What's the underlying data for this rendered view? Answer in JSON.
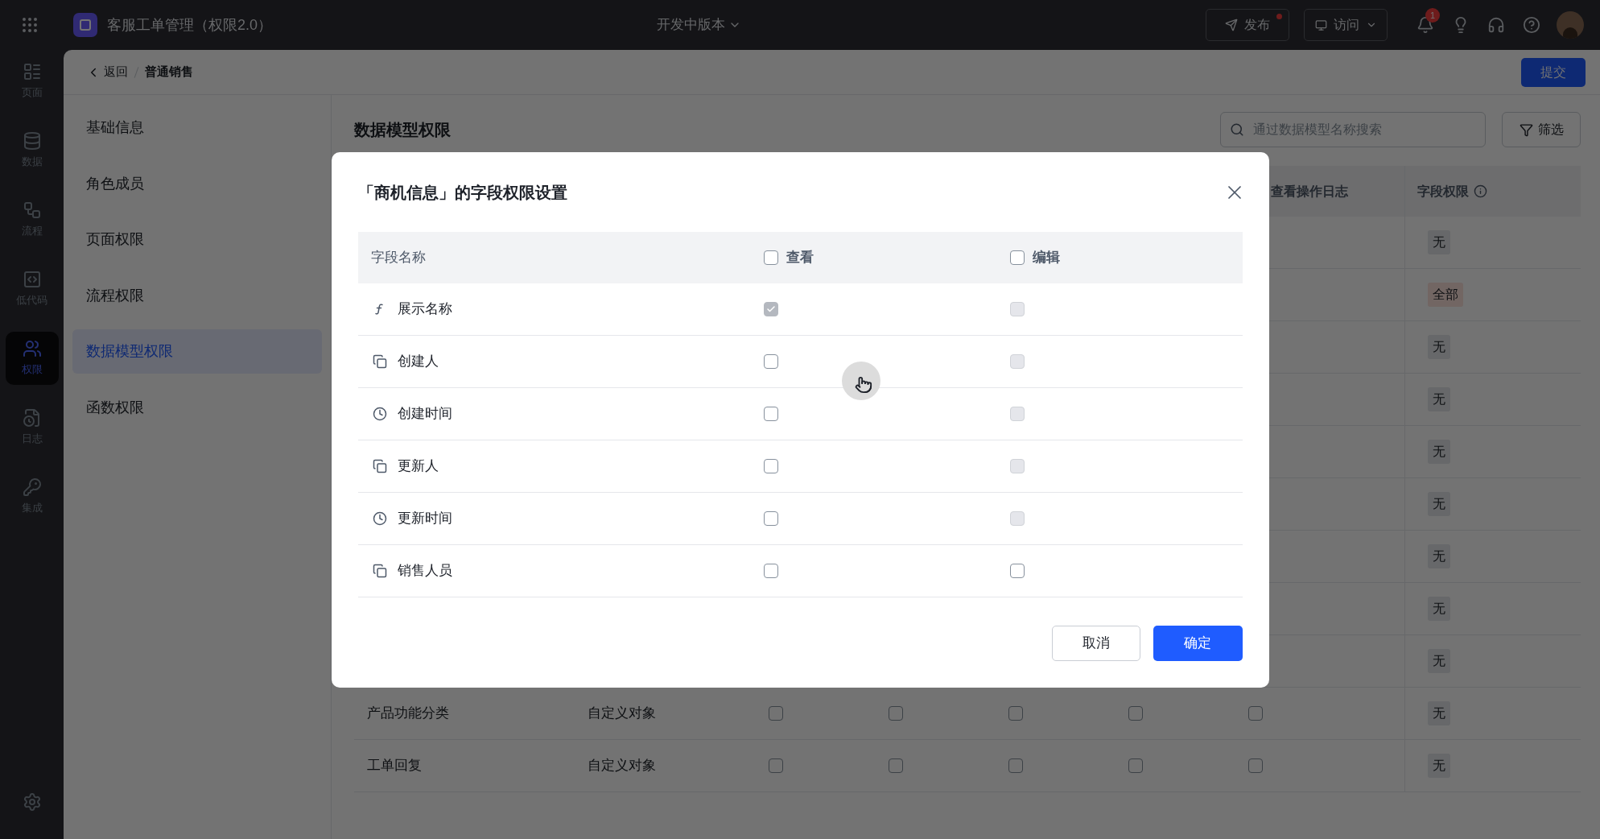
{
  "top_bar": {
    "app_title": "客服工单管理（权限2.0）",
    "version": "开发中版本",
    "publish_button": {
      "label": "发布",
      "unpublished": true
    },
    "visit_button": "访问",
    "notification_count": "1"
  },
  "rail": {
    "items": [
      {
        "kind": "page",
        "label": "页面",
        "selected": false
      },
      {
        "kind": "data",
        "label": "数据",
        "selected": false
      },
      {
        "kind": "flow",
        "label": "流程",
        "selected": false
      },
      {
        "kind": "code",
        "label": "低代码",
        "selected": false
      },
      {
        "kind": "permission",
        "label": "权限",
        "selected": true
      },
      {
        "kind": "log",
        "label": "日志",
        "selected": false
      },
      {
        "kind": "integration",
        "label": "集成",
        "selected": false
      }
    ]
  },
  "breadcrumb": {
    "back": "返回",
    "current": "普通销售"
  },
  "submit_button": "提交",
  "menu": {
    "items": [
      {
        "label": "基础信息",
        "selected": false
      },
      {
        "label": "角色成员",
        "selected": false
      },
      {
        "label": "页面权限",
        "selected": false
      },
      {
        "label": "流程权限",
        "selected": false
      },
      {
        "label": "数据模型权限",
        "selected": true
      },
      {
        "label": "函数权限",
        "selected": false
      }
    ]
  },
  "main": {
    "title": "数据模型权限",
    "search": {
      "placeholder": "通过数据模型名称搜索"
    },
    "filter_button": "筛选",
    "table": {
      "columns": [
        {
          "label": "查看操作日志",
          "kind": "plain"
        },
        {
          "label": "字段权限",
          "kind": "info"
        }
      ],
      "rows": [
        {
          "field_permission": {
            "text": "无",
            "color": "#67686a"
          }
        },
        {
          "field_permission": {
            "text": "全部",
            "color": "#726663"
          }
        },
        {
          "field_permission": {
            "text": "无",
            "color": "#67686a"
          }
        },
        {
          "field_permission": {
            "text": "无",
            "color": "#67686a"
          }
        },
        {
          "field_permission": {
            "text": "无",
            "color": "#67686a"
          }
        },
        {
          "field_permission": {
            "text": "无",
            "color": "#67686a"
          }
        },
        {
          "field_permission": {
            "text": "无",
            "color": "#67686a"
          }
        },
        {
          "field_permission": {
            "text": "无",
            "color": "#67686a"
          }
        },
        {
          "field_permission": {
            "text": "无",
            "color": "#67686a"
          }
        },
        {
          "name": "产品功能分类",
          "type": "自定义对象",
          "checks": [
            {
              "checked": false
            },
            {
              "checked": false
            },
            {
              "checked": false
            },
            {
              "checked": false
            },
            {
              "checked": false
            }
          ],
          "field_permission": {
            "text": "无",
            "color": "#67686a"
          }
        },
        {
          "name": "工单回复",
          "type": "自定义对象",
          "checks": [
            {
              "checked": false
            },
            {
              "checked": false
            },
            {
              "checked": false
            },
            {
              "checked": false
            },
            {
              "checked": false
            }
          ],
          "field_permission": {
            "text": "无",
            "color": "#67686a"
          }
        }
      ]
    }
  },
  "modal": {
    "title": "「商机信息」的字段权限设置",
    "header": {
      "name": "字段名称",
      "view": {
        "label": "查看",
        "checked": false
      },
      "edit": {
        "label": "编辑",
        "checked": false
      }
    },
    "rows": [
      {
        "kind": "formula",
        "name": "展示名称",
        "view": {
          "checked": true,
          "disabled": true
        },
        "edit": {
          "checked": false,
          "disabled": true
        }
      },
      {
        "kind": "relation",
        "name": "创建人",
        "view": {
          "checked": false,
          "disabled": false
        },
        "edit": {
          "checked": false,
          "disabled": true
        }
      },
      {
        "kind": "time",
        "name": "创建时间",
        "view": {
          "checked": false,
          "disabled": false
        },
        "edit": {
          "checked": false,
          "disabled": true
        }
      },
      {
        "kind": "relation",
        "name": "更新人",
        "view": {
          "checked": false,
          "disabled": false
        },
        "edit": {
          "checked": false,
          "disabled": true
        }
      },
      {
        "kind": "time",
        "name": "更新时间",
        "view": {
          "checked": false,
          "disabled": false
        },
        "edit": {
          "checked": false,
          "disabled": true
        }
      },
      {
        "kind": "relation",
        "name": "销售人员",
        "view": {
          "checked": false,
          "disabled": false
        },
        "edit": {
          "checked": false,
          "disabled": false
        }
      }
    ],
    "cancel_button": "取消",
    "ok_button": "确定"
  }
}
